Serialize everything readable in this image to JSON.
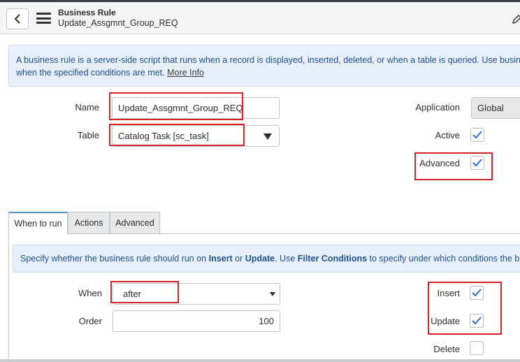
{
  "header": {
    "title": "Business Rule",
    "subtitle": "Update_Assgmnt_Group_REQ"
  },
  "info": {
    "text": "A business rule is a server-side script that runs when a record is displayed, inserted, deleted, or when a table is queried. Use business r",
    "text2": "when the specified conditions are met. ",
    "more_link": "More Info"
  },
  "form": {
    "name_label": "Name",
    "name_value": "Update_Assgmnt_Group_REQ",
    "table_label": "Table",
    "table_value": "Catalog Task [sc_task]",
    "application_label": "Application",
    "application_value": "Global",
    "active_label": "Active",
    "active_checked": true,
    "advanced_label": "Advanced",
    "advanced_checked": true
  },
  "tabs": [
    {
      "label": "When to run",
      "active": true
    },
    {
      "label": "Actions",
      "active": false
    },
    {
      "label": "Advanced",
      "active": false
    }
  ],
  "when_panel": {
    "info_parts": [
      "Specify whether the business rule should run on ",
      "Insert",
      " or ",
      "Update",
      ". Use ",
      "Filter Conditions",
      " to specify under which conditions the busines"
    ],
    "when_label": "When",
    "when_value": "after",
    "order_label": "Order",
    "order_value": "100",
    "insert_label": "Insert",
    "insert_checked": true,
    "update_label": "Update",
    "update_checked": true,
    "delete_label": "Delete",
    "delete_checked": false
  },
  "colors": {
    "highlight": "#d1232a",
    "checkmark": "#2e6fd1",
    "info_bg": "#e7f0fa"
  }
}
